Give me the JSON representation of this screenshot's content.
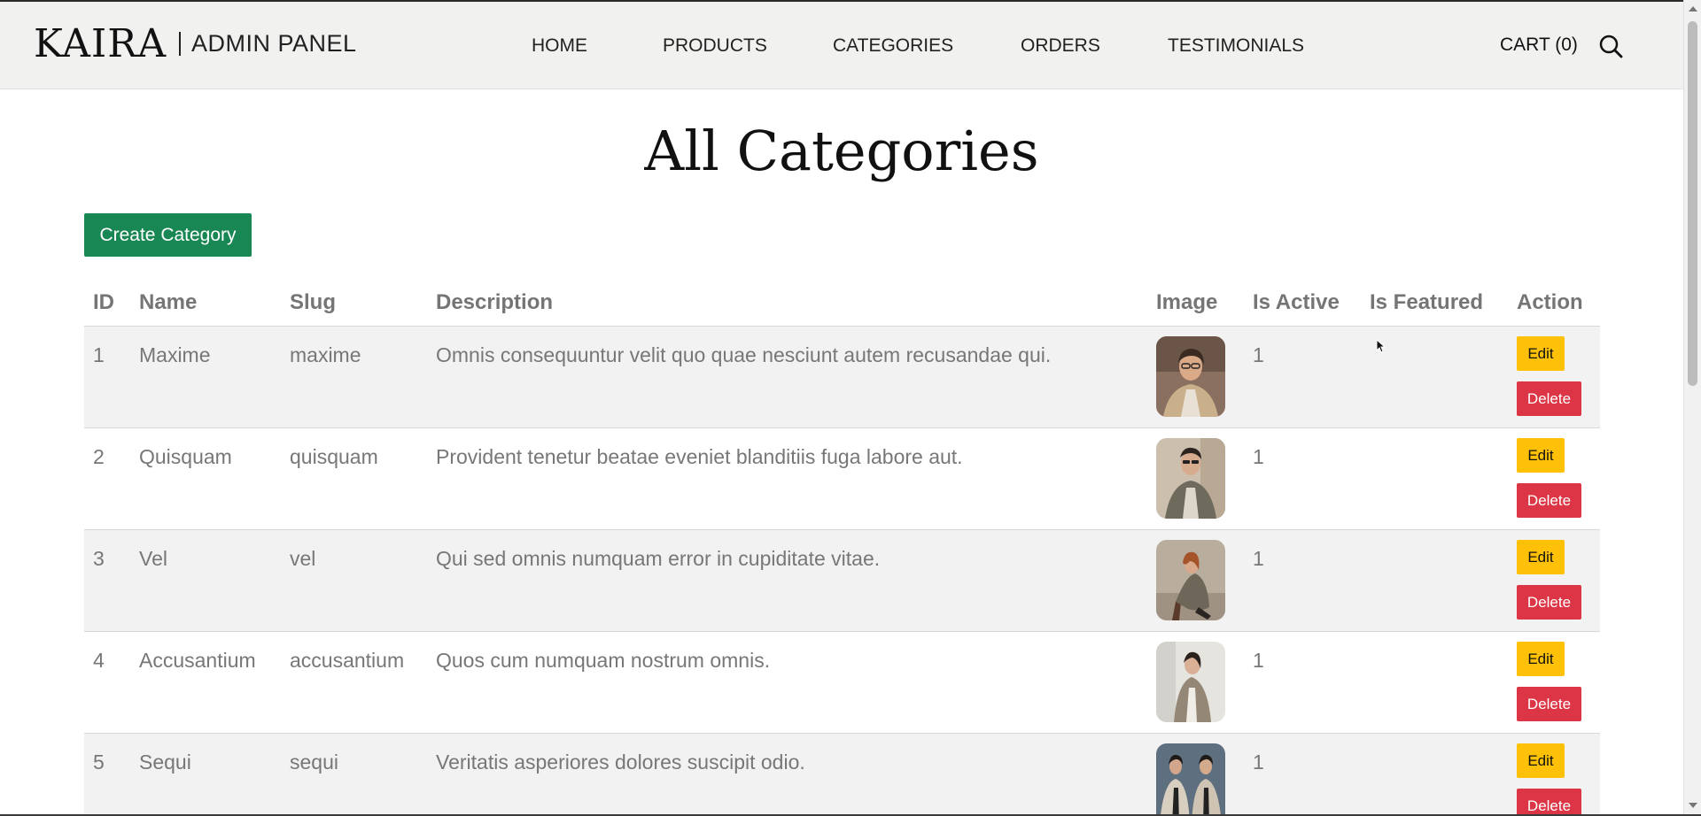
{
  "header": {
    "logo": "KAIRA",
    "subtitle": "ADMIN PANEL",
    "nav": [
      {
        "label": "HOME"
      },
      {
        "label": "PRODUCTS"
      },
      {
        "label": "CATEGORIES"
      },
      {
        "label": "ORDERS"
      },
      {
        "label": "TESTIMONIALS"
      }
    ],
    "cart_label": "CART (0)"
  },
  "main": {
    "title": "All Categories",
    "create_button": "Create Category",
    "columns": [
      "ID",
      "Name",
      "Slug",
      "Description",
      "Image",
      "Is Active",
      "Is Featured",
      "Action"
    ],
    "rows": [
      {
        "id": "1",
        "name": "Maxime",
        "slug": "maxime",
        "description": "Omnis consequuntur velit quo quae nesciunt autem recusandae qui.",
        "is_active": "1",
        "is_featured": "",
        "edit": "Edit",
        "delete": "Delete"
      },
      {
        "id": "2",
        "name": "Quisquam",
        "slug": "quisquam",
        "description": "Provident tenetur beatae eveniet blanditiis fuga labore aut.",
        "is_active": "1",
        "is_featured": "",
        "edit": "Edit",
        "delete": "Delete"
      },
      {
        "id": "3",
        "name": "Vel",
        "slug": "vel",
        "description": "Qui sed omnis numquam error in cupiditate vitae.",
        "is_active": "1",
        "is_featured": "",
        "edit": "Edit",
        "delete": "Delete"
      },
      {
        "id": "4",
        "name": "Accusantium",
        "slug": "accusantium",
        "description": "Quos cum numquam nostrum omnis.",
        "is_active": "1",
        "is_featured": "",
        "edit": "Edit",
        "delete": "Delete"
      },
      {
        "id": "5",
        "name": "Sequi",
        "slug": "sequi",
        "description": "Veritatis asperiores dolores suscipit odio.",
        "is_active": "1",
        "is_featured": "",
        "edit": "Edit",
        "delete": "Delete"
      }
    ]
  },
  "colors": {
    "header_bg": "#f1f1f0",
    "create_button": "#198754",
    "edit_button": "#ffc107",
    "delete_button": "#dc3545",
    "row_stripe": "#f2f2f2"
  },
  "icons": {
    "search": "search-icon",
    "cursor": "mouse-cursor"
  }
}
